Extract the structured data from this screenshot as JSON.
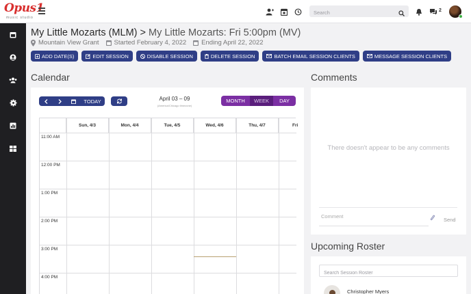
{
  "app": {
    "logo_text": "Opus1",
    "logo_subtitle": "music studio"
  },
  "topbar": {
    "search_placeholder": "Search",
    "messages_count": "2",
    "icons": [
      "add-user-icon",
      "calendar-icon",
      "history-icon",
      "bell-icon",
      "chat-icon"
    ]
  },
  "sidebar": {
    "items": [
      "calendar-icon",
      "user-icon",
      "users-icon",
      "gear-icon",
      "report-icon",
      "grid-icon"
    ]
  },
  "header": {
    "title_main": "My Little Mozarts (MLM) > ",
    "title_sub": "My Little Mozarts: Fri 5:00pm (MV)",
    "location": "Mountain View Grant",
    "started": "Started February 4, 2022",
    "ending": "Ending April 22, 2022"
  },
  "actions": {
    "add_dates": "ADD DATE(S)",
    "edit_session": "EDIT SESSION",
    "disable_session": "DISABLE SESSION",
    "delete_session": "DELETE SESSION",
    "batch_email": "BATCH EMAIL SESSION CLIENTS",
    "message_clients": "MESSAGE SESSION CLIENTS"
  },
  "calendar": {
    "title": "Calendar",
    "today_label": "TODAY",
    "range": "April 03 – 09",
    "timezone": "(America/Chicago timezone)",
    "views": [
      "MONTH",
      "WEEK",
      "DAY"
    ],
    "active_view": "WEEK",
    "days": [
      "Sun, 4/3",
      "Mon, 4/4",
      "Tue, 4/5",
      "Wed, 4/6",
      "Thu, 4/7",
      "Fri"
    ],
    "times": [
      "11:00 AM",
      "12:00 PM",
      "1:00 PM",
      "2:00 PM",
      "3:00 PM",
      "4:00 PM"
    ]
  },
  "comments": {
    "title": "Comments",
    "empty_text": "There doesn't appear to be any comments",
    "placeholder": "Comment",
    "send_label": "Send"
  },
  "roster": {
    "title": "Upcoming Roster",
    "search_placeholder": "Search Session Roster",
    "first_client": "Christopher Myers"
  },
  "colors": {
    "primary": "#2f3e86",
    "view_toggle": "#7b2fa3",
    "sidebar": "#1f1f22",
    "logo": "#d9302f"
  }
}
